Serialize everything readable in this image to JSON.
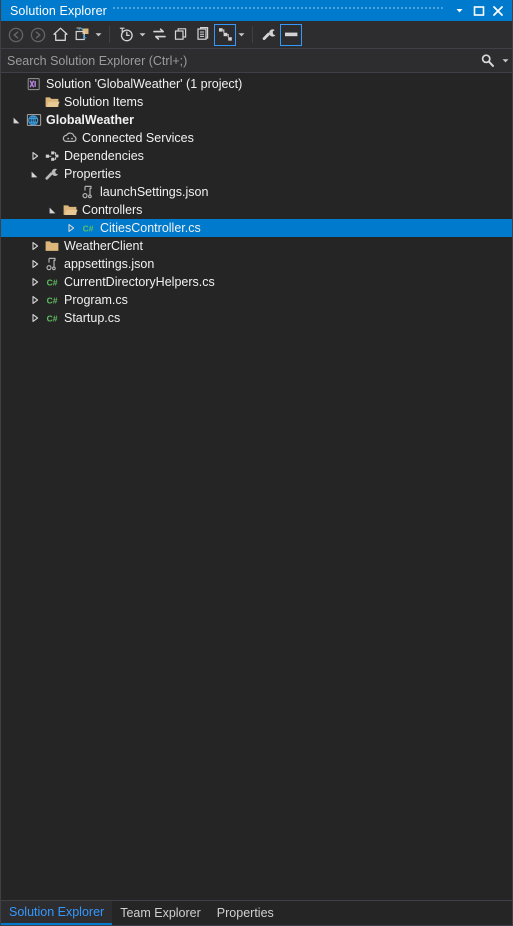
{
  "window": {
    "title": "Solution Explorer",
    "buttons": [
      {
        "name": "dropdown-menu-button",
        "icon": "chevron-down-icon"
      },
      {
        "name": "maximize-button",
        "icon": "maximize-icon"
      },
      {
        "name": "close-button",
        "icon": "close-icon"
      }
    ]
  },
  "toolbar": {
    "items": [
      {
        "name": "back-button",
        "icon": "back-arrow-icon",
        "tooltip": "Back",
        "state": "disabled"
      },
      {
        "name": "forward-button",
        "icon": "forward-arrow-icon",
        "tooltip": "Forward",
        "state": "disabled"
      },
      {
        "name": "home-button",
        "icon": "home-icon",
        "tooltip": "Home",
        "state": "normal"
      },
      {
        "name": "pending-changes-button",
        "icon": "pending-changes-icon",
        "tooltip": "Pending Changes Filter",
        "state": "normal",
        "has_caret": true
      },
      {
        "name": "separator-1",
        "icon": "separator",
        "tooltip": "",
        "state": "separator"
      },
      {
        "name": "history-button",
        "icon": "clock-history-icon",
        "tooltip": "Show History",
        "state": "normal",
        "has_caret": true
      },
      {
        "name": "sync-with-active-document",
        "icon": "sync-arrows-icon",
        "tooltip": "Sync with Active Document",
        "state": "normal"
      },
      {
        "name": "refresh-button",
        "icon": "refresh-window-icon",
        "tooltip": "Refresh",
        "state": "normal"
      },
      {
        "name": "collapse-all-button",
        "icon": "collapse-all-icon",
        "tooltip": "Collapse All",
        "state": "normal"
      },
      {
        "name": "show-all-files-button",
        "icon": "show-all-files-icon",
        "tooltip": "Show All Files",
        "state": "toggled",
        "has_caret": true
      },
      {
        "name": "separator-2",
        "icon": "separator",
        "tooltip": "",
        "state": "separator"
      },
      {
        "name": "properties-button",
        "icon": "wrench-icon",
        "tooltip": "Properties",
        "state": "normal"
      },
      {
        "name": "preview-pane-button",
        "icon": "preview-pane-icon",
        "tooltip": "Preview Selected Items",
        "state": "toggled"
      }
    ]
  },
  "search": {
    "placeholder": "Search Solution Explorer (Ctrl+;)",
    "value": "",
    "icon": "search-icon",
    "caret_icon": "chevron-down-icon"
  },
  "tree": {
    "rows": [
      {
        "label": "Solution 'GlobalWeather' (1 project)",
        "indent": 0,
        "expander": "none",
        "icon": "solution-icon",
        "bold": false,
        "selected": false
      },
      {
        "label": "Solution Items",
        "indent": 1,
        "expander": "none",
        "icon": "folder-open-icon",
        "bold": false,
        "selected": false
      },
      {
        "label": "GlobalWeather",
        "indent": 0,
        "expander": "expanded",
        "icon": "web-project-icon",
        "bold": true,
        "selected": false
      },
      {
        "label": "Connected Services",
        "indent": 2,
        "expander": "none",
        "icon": "connected-services-icon",
        "bold": false,
        "selected": false
      },
      {
        "label": "Dependencies",
        "indent": 1,
        "expander": "collapsed",
        "icon": "dependencies-icon",
        "bold": false,
        "selected": false
      },
      {
        "label": "Properties",
        "indent": 1,
        "expander": "expanded",
        "icon": "wrench-icon",
        "bold": false,
        "selected": false
      },
      {
        "label": "launchSettings.json",
        "indent": 3,
        "expander": "none",
        "icon": "json-file-icon",
        "bold": false,
        "selected": false
      },
      {
        "label": "Controllers",
        "indent": 2,
        "expander": "expanded",
        "icon": "folder-open-icon",
        "bold": false,
        "selected": false
      },
      {
        "label": "CitiesController.cs",
        "indent": 3,
        "expander": "collapsed",
        "icon": "csharp-file-icon",
        "bold": false,
        "selected": true
      },
      {
        "label": "WeatherClient",
        "indent": 1,
        "expander": "collapsed",
        "icon": "folder-closed-icon",
        "bold": false,
        "selected": false
      },
      {
        "label": "appsettings.json",
        "indent": 1,
        "expander": "collapsed",
        "icon": "json-file-icon",
        "bold": false,
        "selected": false
      },
      {
        "label": "CurrentDirectoryHelpers.cs",
        "indent": 1,
        "expander": "collapsed",
        "icon": "csharp-file-icon",
        "bold": false,
        "selected": false
      },
      {
        "label": "Program.cs",
        "indent": 1,
        "expander": "collapsed",
        "icon": "csharp-file-icon",
        "bold": false,
        "selected": false
      },
      {
        "label": "Startup.cs",
        "indent": 1,
        "expander": "collapsed",
        "icon": "csharp-file-icon",
        "bold": false,
        "selected": false
      }
    ]
  },
  "tabs": [
    {
      "label": "Solution Explorer",
      "active": true
    },
    {
      "label": "Team Explorer",
      "active": false
    },
    {
      "label": "Properties",
      "active": false
    }
  ],
  "colors": {
    "accent": "#007acc",
    "titlebar": "#007acc",
    "toolbar_bg": "#2d2d30",
    "panel_bg": "#252526",
    "border": "#3f3f46",
    "text": "#f1f1f1",
    "muted_text": "#9b9b9b",
    "active_tab_text": "#3399ff",
    "folder": "#dcb67a",
    "csharp_green": "#60c060",
    "solution_purple": "#b180d7",
    "web_blue": "#3a9ad9"
  }
}
